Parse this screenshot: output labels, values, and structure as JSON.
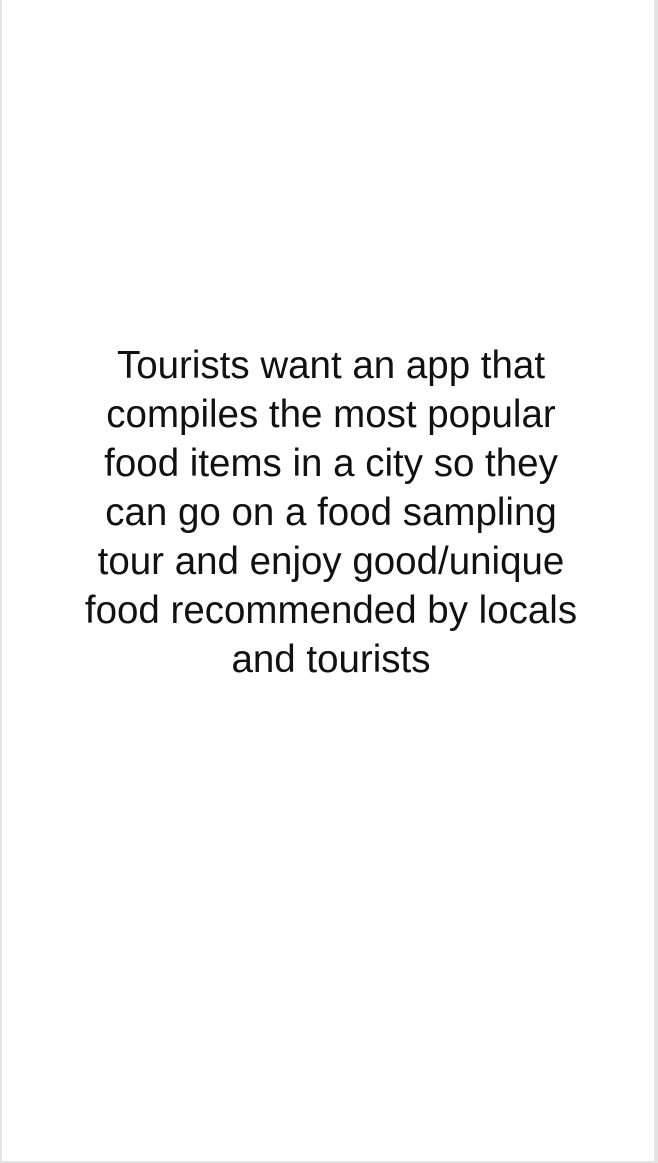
{
  "statement": {
    "text": "Tourists want an app that compiles the most popular food items in a city so they can go on a food sampling tour and enjoy good/unique food recommended by locals and tourists"
  }
}
